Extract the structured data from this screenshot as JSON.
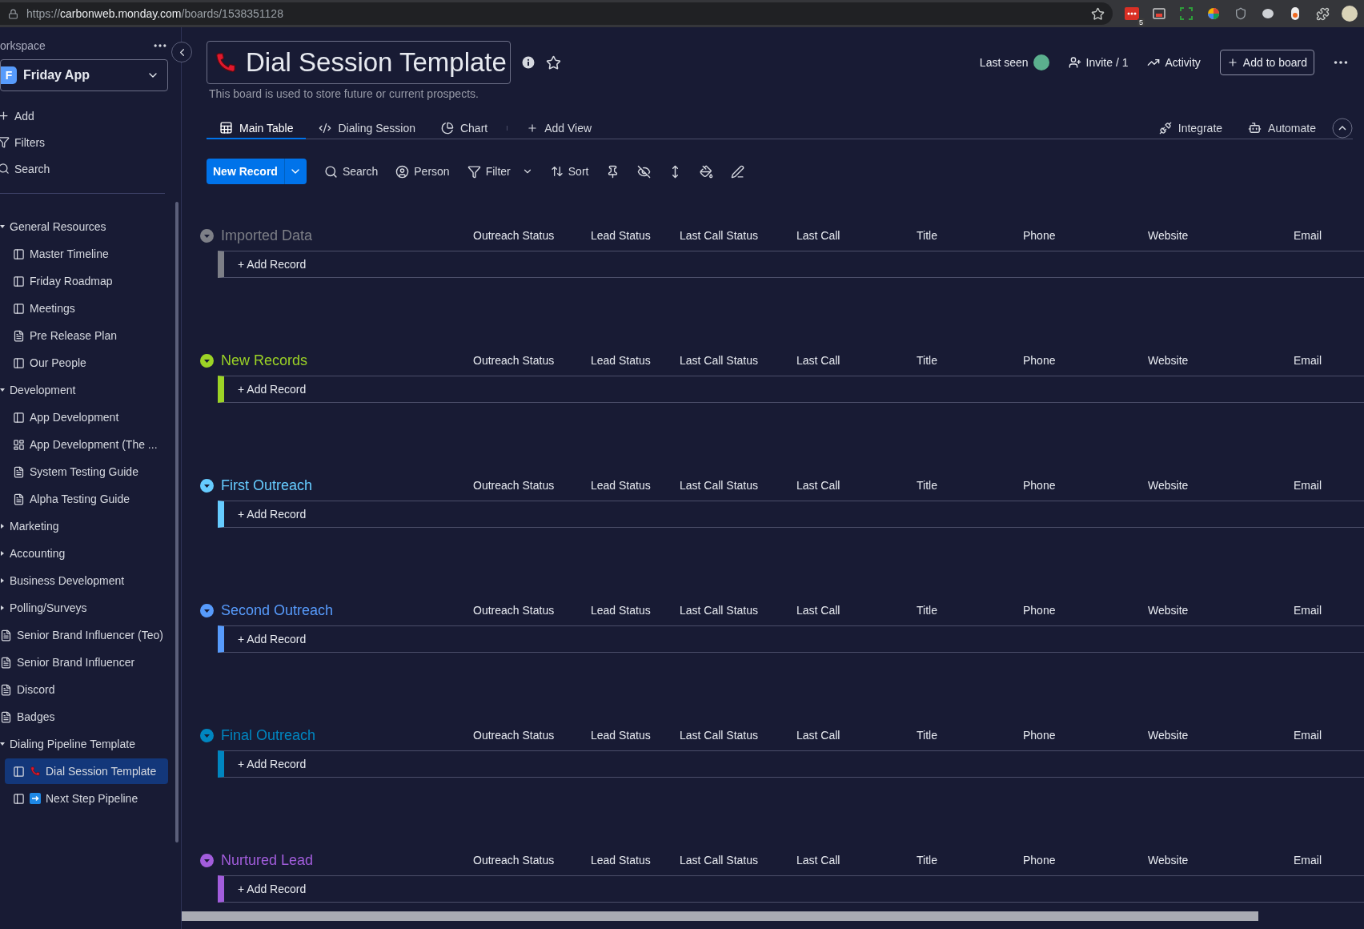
{
  "browser": {
    "url_scheme": "https://",
    "url_host": "carbonweb.monday.com",
    "url_path": "/boards/1538351128",
    "extension_badge": "5"
  },
  "sidebar": {
    "workspace_label": "orkspace",
    "workspace": {
      "initial": "F",
      "name": "Friday App"
    },
    "actions": [
      {
        "kind": "add",
        "label": "Add"
      },
      {
        "kind": "filter",
        "label": "Filters"
      },
      {
        "kind": "search",
        "label": "Search"
      }
    ],
    "items": [
      {
        "kind": "folder",
        "label": "General Resources",
        "expanded": true,
        "selected": false,
        "children": [
          {
            "kind": "board",
            "label": "Master Timeline",
            "selected": false
          },
          {
            "kind": "board",
            "label": "Friday Roadmap",
            "selected": false
          },
          {
            "kind": "board",
            "label": "Meetings",
            "selected": false
          },
          {
            "kind": "doc",
            "label": "Pre Release Plan",
            "selected": false
          },
          {
            "kind": "board",
            "label": "Our People",
            "selected": false
          }
        ]
      },
      {
        "kind": "folder",
        "label": "Development",
        "expanded": true,
        "selected": false,
        "children": [
          {
            "kind": "board",
            "label": "App Development",
            "selected": false
          },
          {
            "kind": "shared",
            "label": "App Development (The ...",
            "selected": false
          },
          {
            "kind": "doc",
            "label": "System Testing Guide",
            "selected": false
          },
          {
            "kind": "doc",
            "label": "Alpha Testing Guide",
            "selected": false
          }
        ]
      },
      {
        "kind": "folder",
        "label": "Marketing",
        "expanded": false,
        "selected": false
      },
      {
        "kind": "folder",
        "label": "Accounting",
        "expanded": false,
        "selected": false
      },
      {
        "kind": "folder",
        "label": "Business Development",
        "expanded": false,
        "selected": false
      },
      {
        "kind": "folder",
        "label": "Polling/Surveys",
        "expanded": false,
        "selected": false
      },
      {
        "kind": "doc",
        "label": "Senior Brand Influencer (Teo)",
        "selected": false
      },
      {
        "kind": "doc",
        "label": "Senior Brand Influencer",
        "selected": false
      },
      {
        "kind": "doc",
        "label": "Discord",
        "selected": false
      },
      {
        "kind": "doc",
        "label": "Badges",
        "selected": false
      },
      {
        "kind": "folder",
        "label": "Dialing Pipeline Template",
        "expanded": true,
        "selected": false,
        "children": [
          {
            "kind": "board",
            "emoji": {
              "kind": "phone"
            },
            "label": "Dial Session Template",
            "selected": true
          },
          {
            "kind": "board",
            "emoji": {
              "kind": "arrow"
            },
            "label": "Next Step Pipeline",
            "selected": false
          }
        ]
      }
    ]
  },
  "board": {
    "title": "Dial Session Template",
    "description": "This board is used to store future or current prospects.",
    "last_seen": "Last seen",
    "invite": "Invite / 1",
    "activity": "Activity",
    "add_to_board": "Add to board",
    "views": [
      {
        "kind": "table",
        "label": "Main Table",
        "selected": true
      },
      {
        "kind": "code",
        "label": "Dialing Session",
        "selected": false
      },
      {
        "kind": "chart",
        "label": "Chart",
        "selected": false
      }
    ],
    "add_view": "Add View",
    "integrate": "Integrate",
    "automate": "Automate"
  },
  "toolbar": {
    "new_record": "New Record",
    "tools": [
      {
        "kind": "search",
        "label": "Search"
      },
      {
        "kind": "person",
        "label": "Person"
      },
      {
        "kind": "filter",
        "label": "Filter"
      },
      {
        "kind": "sort",
        "label": "Sort"
      },
      {
        "kind": "pin"
      },
      {
        "kind": "hide"
      },
      {
        "kind": "height"
      },
      {
        "kind": "color"
      },
      {
        "kind": "edit"
      }
    ]
  },
  "groups": [
    {
      "name": "Imported Data",
      "color": "#7d7f87",
      "columns": [
        "Outreach Status",
        "Lead Status",
        "Last Call Status",
        "Last Call",
        "Title",
        "Phone",
        "Website",
        "Email"
      ],
      "add_label": "+ Add Record"
    },
    {
      "name": "New Records",
      "color": "#9cd326",
      "columns": [
        "Outreach Status",
        "Lead Status",
        "Last Call Status",
        "Last Call",
        "Title",
        "Phone",
        "Website",
        "Email"
      ],
      "add_label": "+ Add Record"
    },
    {
      "name": "First Outreach",
      "color": "#66ccff",
      "columns": [
        "Outreach Status",
        "Lead Status",
        "Last Call Status",
        "Last Call",
        "Title",
        "Phone",
        "Website",
        "Email"
      ],
      "add_label": "+ Add Record"
    },
    {
      "name": "Second Outreach",
      "color": "#579bfc",
      "columns": [
        "Outreach Status",
        "Lead Status",
        "Last Call Status",
        "Last Call",
        "Title",
        "Phone",
        "Website",
        "Email"
      ],
      "add_label": "+ Add Record"
    },
    {
      "name": "Final Outreach",
      "color": "#0086c0",
      "columns": [
        "Outreach Status",
        "Lead Status",
        "Last Call Status",
        "Last Call",
        "Title",
        "Phone",
        "Website",
        "Email"
      ],
      "add_label": "+ Add Record"
    },
    {
      "name": "Nurtured Lead",
      "color": "#a25ddc",
      "columns": [
        "Outreach Status",
        "Lead Status",
        "Last Call Status",
        "Last Call",
        "Title",
        "Phone",
        "Website",
        "Email"
      ],
      "add_label": "+ Add Record"
    }
  ]
}
